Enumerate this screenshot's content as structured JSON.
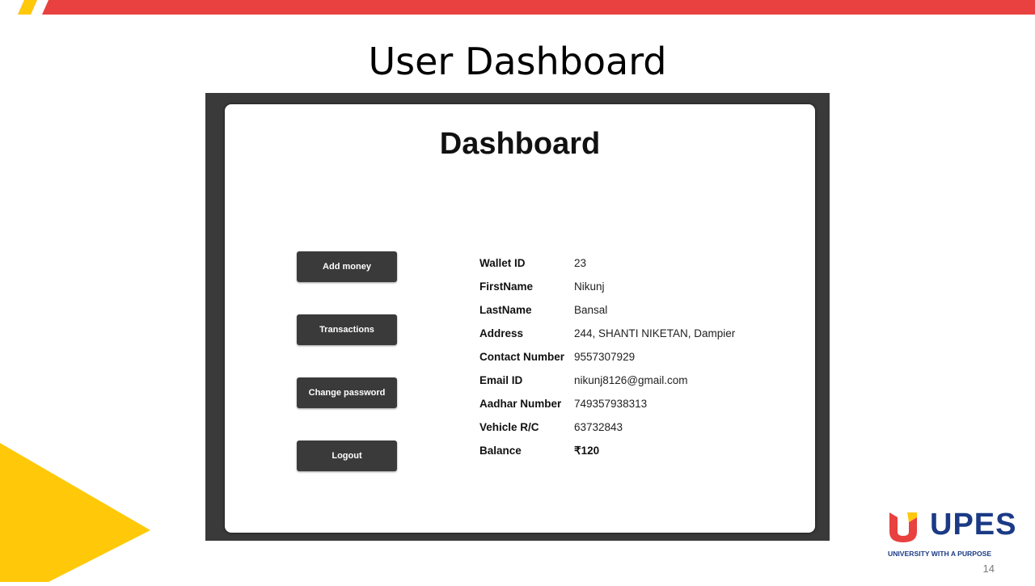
{
  "slide": {
    "title": "User Dashboard",
    "page_number": "14"
  },
  "colors": {
    "top_bar_red": "#e8413f",
    "accent_yellow": "#ffc90a",
    "brand_blue": "#1b3a86",
    "button_dark": "#3a3a3a"
  },
  "dashboard": {
    "title": "Dashboard",
    "buttons": [
      {
        "label": "Add money"
      },
      {
        "label": "Transactions"
      },
      {
        "label": "Change password"
      },
      {
        "label": "Logout"
      }
    ],
    "fields": [
      {
        "label": "Wallet ID",
        "value": "23"
      },
      {
        "label": "FirstName",
        "value": "Nikunj"
      },
      {
        "label": "LastName",
        "value": "Bansal"
      },
      {
        "label": "Address",
        "value": "244, SHANTI NIKETAN, Dampier"
      },
      {
        "label": "Contact Number",
        "value": "9557307929"
      },
      {
        "label": "Email ID",
        "value": "nikunj8126@gmail.com"
      },
      {
        "label": "Aadhar Number",
        "value": "749357938313"
      },
      {
        "label": "Vehicle R/C",
        "value": "63732843"
      },
      {
        "label": "Balance",
        "value": "₹120"
      }
    ]
  },
  "logo": {
    "name": "UPES",
    "tagline": "UNIVERSITY WITH A PURPOSE"
  }
}
